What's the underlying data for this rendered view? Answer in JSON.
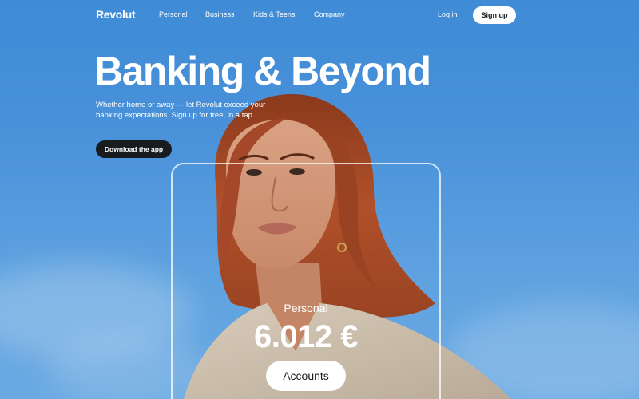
{
  "nav": {
    "logo": "Revolut",
    "links": [
      "Personal",
      "Business",
      "Kids & Teens",
      "Company"
    ],
    "login": "Log in",
    "signup": "Sign up"
  },
  "hero": {
    "title": "Banking & Beyond",
    "subtitle": "Whether home or away — let Revolut exceed your banking expectations. Sign up for free, in a tap.",
    "cta": "Download the app"
  },
  "card": {
    "label": "Personal",
    "amount": "6.012 €",
    "button": "Accounts"
  },
  "colors": {
    "sky": "#4a92da",
    "dark_button": "#191c1f",
    "hair": "#b0502a"
  }
}
